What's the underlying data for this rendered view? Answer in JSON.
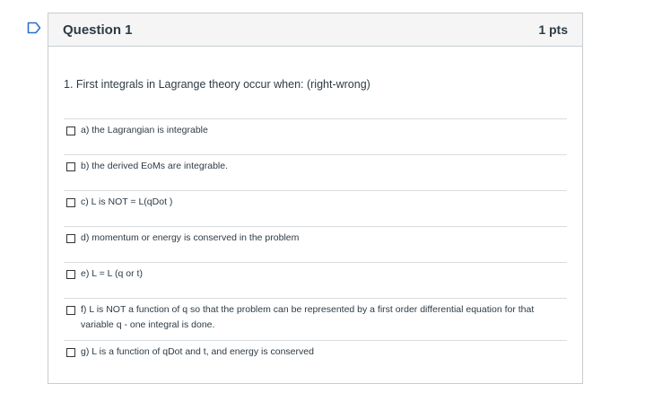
{
  "question": {
    "title": "Question 1",
    "points": "1 pts",
    "text": "1. First integrals in Lagrange theory occur when: (right-wrong)"
  },
  "answers": [
    {
      "label": "a) the Lagrangian is integrable",
      "checked": false
    },
    {
      "label": "b) the derived EoMs are integrable.",
      "checked": false
    },
    {
      "label": "c) L is NOT = L(qDot )",
      "checked": false
    },
    {
      "label": "d) momentum or energy is conserved in the problem",
      "checked": false
    },
    {
      "label": "e) L = L (q or t)",
      "checked": false
    },
    {
      "label": "f) L is NOT a function of q so that the problem can be represented by a first order differential equation for that variable q - one integral is done.",
      "checked": false
    },
    {
      "label": "g) L is a function of qDot and t, and energy is conserved",
      "checked": false
    }
  ],
  "colors": {
    "flag": "#2d6fcf",
    "border": "#c7cdd1",
    "header_bg": "#f5f5f5",
    "text": "#2d3b45"
  },
  "icons": {
    "flag": "bookmark-flag-icon"
  }
}
